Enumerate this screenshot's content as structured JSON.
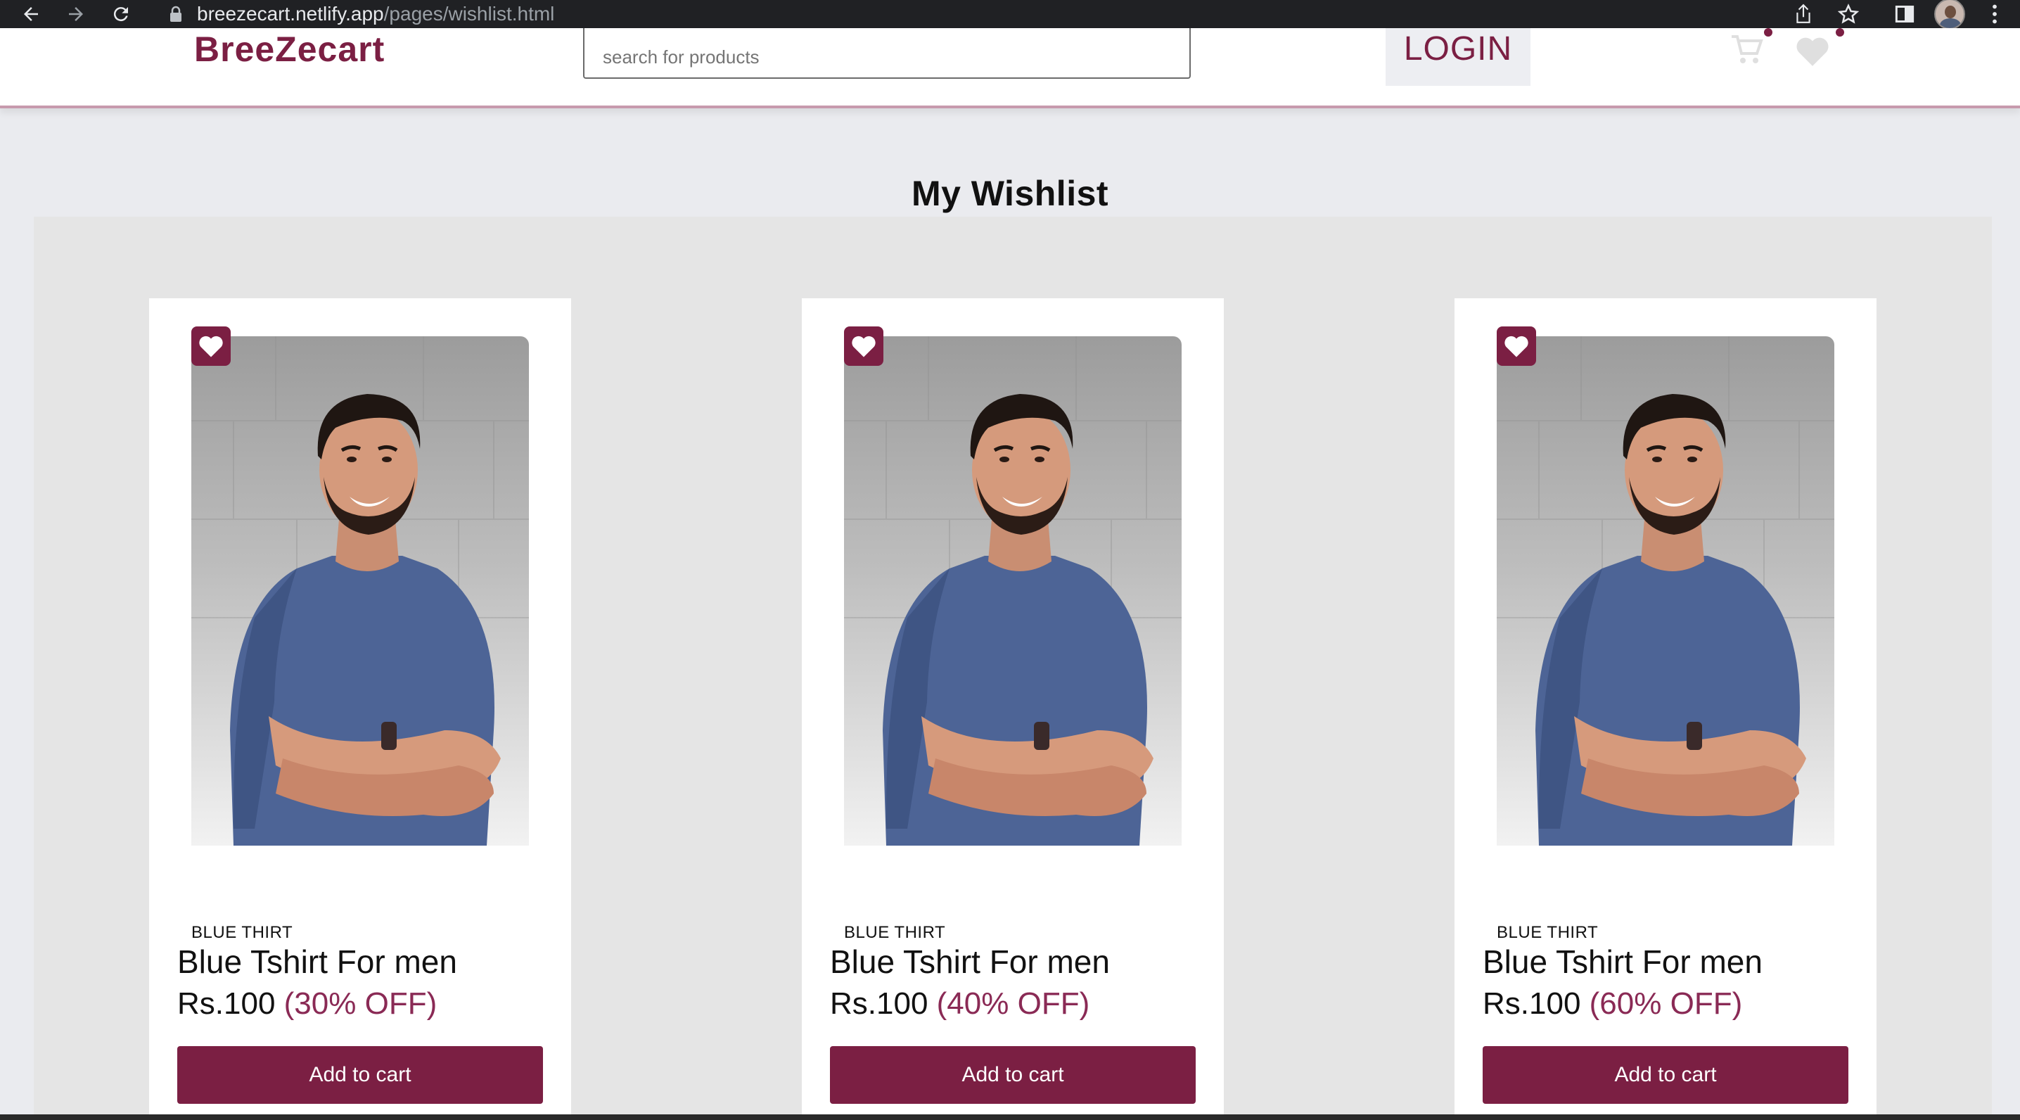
{
  "browser": {
    "url_host": "breezecart.netlify.app",
    "url_path": "/pages/wishlist.html"
  },
  "header": {
    "brand": "BreeZecart",
    "search_placeholder": "search for products",
    "login_label": "LOGIN"
  },
  "main": {
    "title": "My Wishlist"
  },
  "products": [
    {
      "brand": "BLUE THIRT",
      "name": "Blue Tshirt For men",
      "price": "Rs.100",
      "discount": "(30% OFF)",
      "button": "Add to cart"
    },
    {
      "brand": "BLUE THIRT",
      "name": "Blue Tshirt For men",
      "price": "Rs.100",
      "discount": "(40% OFF)",
      "button": "Add to cart"
    },
    {
      "brand": "BLUE THIRT",
      "name": "Blue Tshirt For men",
      "price": "Rs.100",
      "discount": "(60% OFF)",
      "button": "Add to cart"
    }
  ],
  "colors": {
    "brand": "#7b1f43",
    "discount": "#8a2a55",
    "page_bg": "#eaebef",
    "wishlist_bg": "#e5e5e5"
  }
}
